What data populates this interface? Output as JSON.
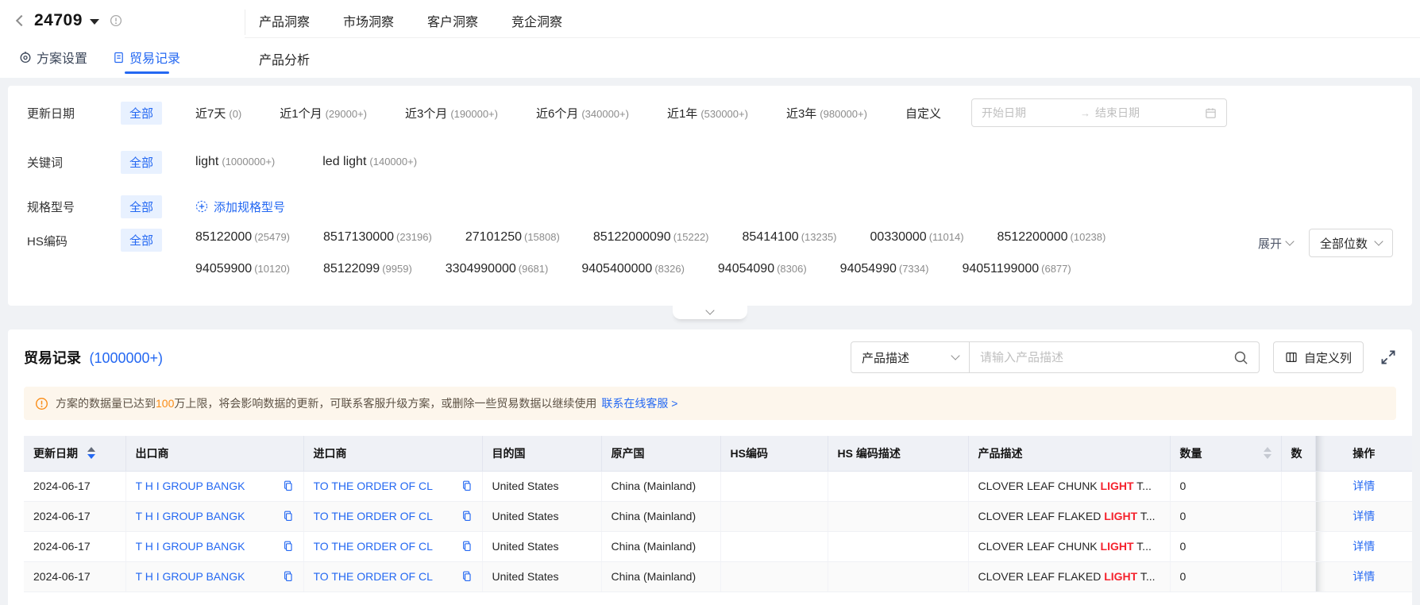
{
  "colors": {
    "primary": "#2468f2",
    "chip_bg": "#e8f1ff",
    "banner_bg": "#fdf6ec",
    "warning_orange": "#fa8c16",
    "highlight_red": "#f5222d",
    "table_header_bg": "#eff1f6"
  },
  "icons": {
    "back": "chevron-left",
    "plan_dropdown": "caret-down",
    "info": "circle-exclamation",
    "plan_settings": "target-gear",
    "trade_records": "clipboard",
    "add": "dashed-circle-plus",
    "range_separator": "→",
    "calendar": "calendar",
    "chevron": "chevron-down",
    "search": "magnifier",
    "customize": "table-columns",
    "fullscreen": "expand-arrows",
    "warning": "circle-exclamation",
    "copy": "copy-sheet"
  },
  "header": {
    "plan_id": "24709",
    "nav": [
      {
        "label": "方案设置"
      },
      {
        "label": "贸易记录"
      }
    ],
    "tabs": [
      {
        "label": "产品洞察"
      },
      {
        "label": "市场洞察"
      },
      {
        "label": "客户洞察"
      },
      {
        "label": "竞企洞察"
      }
    ],
    "subtab": "产品分析"
  },
  "filters": {
    "update_date": {
      "label": "更新日期",
      "all": "全部",
      "options": [
        {
          "name": "近7天",
          "count": "(0)"
        },
        {
          "name": "近1个月",
          "count": "(29000+)"
        },
        {
          "name": "近3个月",
          "count": "(190000+)"
        },
        {
          "name": "近6个月",
          "count": "(340000+)"
        },
        {
          "name": "近1年",
          "count": "(530000+)"
        },
        {
          "name": "近3年",
          "count": "(980000+)"
        }
      ],
      "custom": "自定义",
      "start_placeholder": "开始日期",
      "end_placeholder": "结束日期"
    },
    "keyword": {
      "label": "关键词",
      "all": "全部",
      "options": [
        {
          "name": "light",
          "count": "(1000000+)"
        },
        {
          "name": "led light",
          "count": "(140000+)"
        }
      ]
    },
    "spec": {
      "label": "规格型号",
      "all": "全部",
      "add": "添加规格型号"
    },
    "hs_code": {
      "label": "HS编码",
      "all": "全部",
      "row1": [
        {
          "code": "85122000",
          "count": "(25479)"
        },
        {
          "code": "8517130000",
          "count": "(23196)"
        },
        {
          "code": "27101250",
          "count": "(15808)"
        },
        {
          "code": "85122000090",
          "count": "(15222)"
        },
        {
          "code": "85414100",
          "count": "(13235)"
        },
        {
          "code": "00330000",
          "count": "(11014)"
        },
        {
          "code": "8512200000",
          "count": "(10238)"
        }
      ],
      "row2": [
        {
          "code": "94059900",
          "count": "(10120)"
        },
        {
          "code": "85122099",
          "count": "(9959)"
        },
        {
          "code": "3304990000",
          "count": "(9681)"
        },
        {
          "code": "9405400000",
          "count": "(8326)"
        },
        {
          "code": "94054090",
          "count": "(8306)"
        },
        {
          "code": "94054990",
          "count": "(7334)"
        },
        {
          "code": "94051199000",
          "count": "(6877)"
        }
      ],
      "expand": "展开",
      "digits": "全部位数"
    }
  },
  "records": {
    "title": "贸易记录",
    "count": "(1000000+)",
    "search_field": "产品描述",
    "search_placeholder": "请输入产品描述",
    "customize_columns": "自定义列",
    "banner": {
      "pre": "方案的数据量已达到",
      "highlight": "100",
      "post": "万上限，将会影响数据的更新，可联系客服升级方案，或删除一些贸易数据以继续使用",
      "link": "联系在线客服 >"
    },
    "table": {
      "columns": [
        "更新日期",
        "出口商",
        "进口商",
        "目的国",
        "原产国",
        "HS编码",
        "HS 编码描述",
        "产品描述",
        "数量",
        "数",
        "操作"
      ],
      "action_label": "详情",
      "rows": [
        {
          "date": "2024-06-17",
          "exporter": "T H I GROUP BANGK",
          "importer": "TO THE ORDER OF CL",
          "dest": "United States",
          "origin": "China (Mainland)",
          "desc_pre": "CLOVER LEAF CHUNK ",
          "desc_hl": "LIGHT",
          "desc_post": " T...",
          "qty": "0"
        },
        {
          "date": "2024-06-17",
          "exporter": "T H I GROUP BANGK",
          "importer": "TO THE ORDER OF CL",
          "dest": "United States",
          "origin": "China (Mainland)",
          "desc_pre": "CLOVER LEAF FLAKED ",
          "desc_hl": "LIGHT",
          "desc_post": " T...",
          "qty": "0"
        },
        {
          "date": "2024-06-17",
          "exporter": "T H I GROUP BANGK",
          "importer": "TO THE ORDER OF CL",
          "dest": "United States",
          "origin": "China (Mainland)",
          "desc_pre": "CLOVER LEAF CHUNK ",
          "desc_hl": "LIGHT",
          "desc_post": " T...",
          "qty": "0"
        },
        {
          "date": "2024-06-17",
          "exporter": "T H I GROUP BANGK",
          "importer": "TO THE ORDER OF CL",
          "dest": "United States",
          "origin": "China (Mainland)",
          "desc_pre": "CLOVER LEAF FLAKED ",
          "desc_hl": "LIGHT",
          "desc_post": " T...",
          "qty": "0"
        }
      ]
    }
  }
}
